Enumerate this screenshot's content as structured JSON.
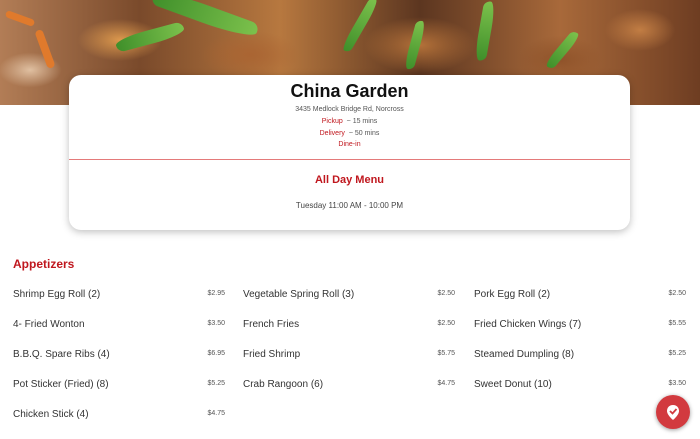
{
  "restaurant": {
    "name": "China Garden",
    "address": "3435 Medlock Bridge Rd, Norcross",
    "pickup_label": "Pickup",
    "pickup_time": "~ 15 mins",
    "delivery_label": "Delivery",
    "delivery_time": "~ 50 mins",
    "dine_in_label": "Dine-in"
  },
  "menu": {
    "name": "All Day Menu",
    "hours": "Tuesday 11:00 AM - 10:00 PM"
  },
  "section": {
    "title": "Appetizers",
    "columns": [
      [
        {
          "name": "Shrimp Egg Roll (2)",
          "price": "$2.95"
        },
        {
          "name": "4- Fried Wonton",
          "price": "$3.50"
        },
        {
          "name": "B.B.Q. Spare Ribs (4)",
          "price": "$6.95"
        },
        {
          "name": "Pot Sticker (Fried) (8)",
          "price": "$5.25"
        },
        {
          "name": "Chicken Stick (4)",
          "price": "$4.75"
        }
      ],
      [
        {
          "name": "Vegetable Spring Roll (3)",
          "price": "$2.50"
        },
        {
          "name": "French Fries",
          "price": "$2.50"
        },
        {
          "name": "Fried Shrimp",
          "price": "$5.75"
        },
        {
          "name": "Crab Rangoon (6)",
          "price": "$4.75"
        }
      ],
      [
        {
          "name": "Pork Egg Roll (2)",
          "price": "$2.50"
        },
        {
          "name": "Fried Chicken Wings (7)",
          "price": "$5.55"
        },
        {
          "name": "Steamed Dumpling (8)",
          "price": "$5.25"
        },
        {
          "name": "Sweet Donut (10)",
          "price": "$3.50"
        }
      ]
    ]
  },
  "colors": {
    "accent": "#c0171e",
    "fab": "#d23a3f"
  },
  "icons": {
    "fab": "order-icon"
  }
}
